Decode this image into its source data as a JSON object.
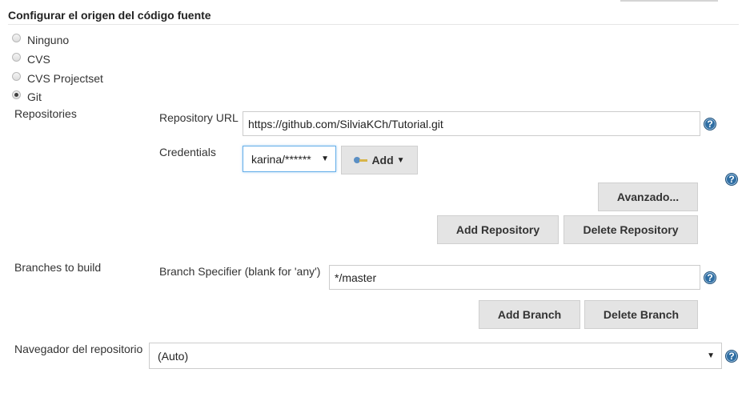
{
  "section": {
    "title": "Configurar el origen del código fuente"
  },
  "scm_options": [
    {
      "label": "Ninguno",
      "checked": false
    },
    {
      "label": "CVS",
      "checked": false
    },
    {
      "label": "CVS Projectset",
      "checked": false
    },
    {
      "label": "Git",
      "checked": true
    }
  ],
  "repositories": {
    "label": "Repositories",
    "url_label": "Repository URL",
    "url_value": "https://github.com/SilviaKCh/Tutorial.git",
    "credentials_label": "Credentials",
    "credentials_value": "karina/******",
    "add_label": "Add",
    "advanced_label": "Avanzado...",
    "add_repo_label": "Add Repository",
    "delete_repo_label": "Delete Repository"
  },
  "branches": {
    "label": "Branches to build",
    "specifier_label": "Branch Specifier (blank for 'any')",
    "specifier_value": "*/master",
    "add_branch_label": "Add Branch",
    "delete_branch_label": "Delete Branch"
  },
  "browser": {
    "label": "Navegador del repositorio",
    "value": "(Auto)"
  },
  "icons": {
    "help": "help-icon",
    "key": "key-icon",
    "caret": "caret-down-icon",
    "help_glyph": "?",
    "caret_glyph": "▼"
  },
  "colors": {
    "help_blue": "#2f6ea3",
    "button_bg": "#e4e4e4",
    "focus_border": "#66afe9"
  }
}
